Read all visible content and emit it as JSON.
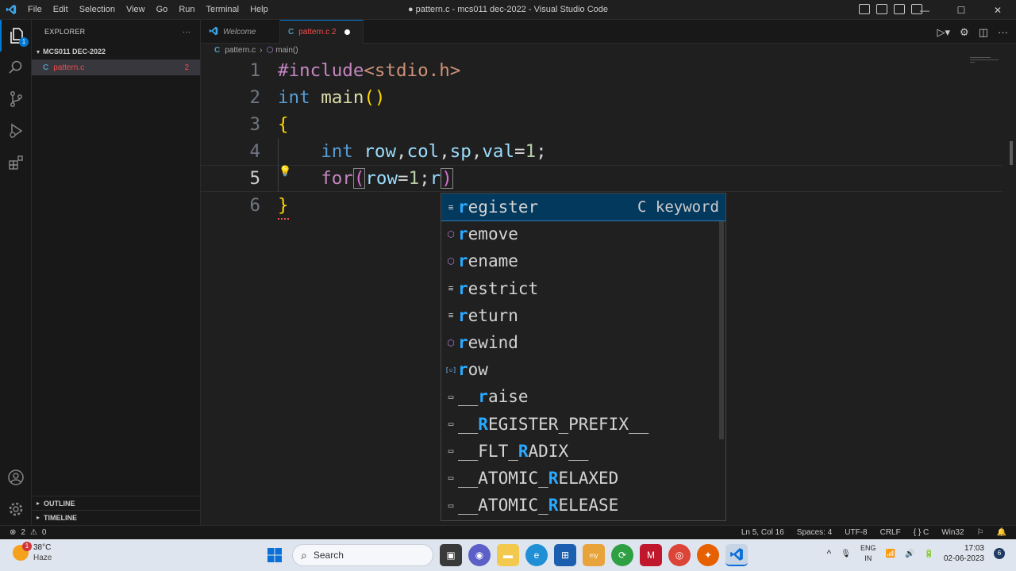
{
  "titlebar": {
    "menu": [
      "File",
      "Edit",
      "Selection",
      "View",
      "Go",
      "Run",
      "Terminal",
      "Help"
    ],
    "window_title": "● pattern.c - mcs011 dec-2022 - Visual Studio Code",
    "minimize": "—",
    "maximize": "☐",
    "close": "✕"
  },
  "activity_bar": {
    "explorer_badge": "1",
    "icons": [
      "files-icon",
      "search-icon",
      "source-control-icon",
      "run-debug-icon",
      "extensions-icon",
      "account-icon",
      "settings-gear-icon"
    ]
  },
  "sidebar": {
    "title": "EXPLORER",
    "more": "···",
    "folder": "MCS011 DEC-2022",
    "file": {
      "icon": "C",
      "name": "pattern.c",
      "problems": "2"
    },
    "outline": "OUTLINE",
    "timeline": "TIMELINE"
  },
  "tabs": [
    {
      "label": "Welcome",
      "icon": "vscode-logo-icon"
    },
    {
      "label": "pattern.c 2",
      "icon": "C",
      "modified": true
    }
  ],
  "breadcrumb": {
    "file": "pattern.c",
    "symbol": "main()"
  },
  "editor": {
    "line_numbers": [
      "1",
      "2",
      "3",
      "4",
      "5",
      "6"
    ],
    "current_line": 5
  },
  "suggestions": [
    {
      "label": "register",
      "match": "r",
      "icon": "keyword-icon",
      "detail": "C keyword"
    },
    {
      "label": "remove",
      "match": "r",
      "icon": "function-icon"
    },
    {
      "label": "rename",
      "match": "r",
      "icon": "function-icon"
    },
    {
      "label": "restrict",
      "match": "r",
      "icon": "keyword-icon"
    },
    {
      "label": "return",
      "match": "r",
      "icon": "keyword-icon"
    },
    {
      "label": "rewind",
      "match": "r",
      "icon": "function-icon"
    },
    {
      "label": "row",
      "match": "r",
      "icon": "variable-icon"
    },
    {
      "label": "__raise",
      "match": "r",
      "icon": "text-icon"
    },
    {
      "label": "__REGISTER_PREFIX__",
      "match": "R",
      "icon": "text-icon"
    },
    {
      "label": "__FLT_RADIX__",
      "match": "R",
      "icon": "text-icon"
    },
    {
      "label": "__ATOMIC_RELAXED",
      "match": "R",
      "icon": "text-icon"
    },
    {
      "label": "__ATOMIC_RELEASE",
      "match": "R",
      "icon": "text-icon"
    }
  ],
  "statusbar": {
    "errors": "2",
    "warnings": "0",
    "position": "Ln 5, Col 16",
    "spaces": "Spaces: 4",
    "encoding": "UTF-8",
    "eol": "CRLF",
    "language": "C",
    "config": "Win32"
  },
  "taskbar": {
    "weather_temp": "38°C",
    "weather_desc": "Haze",
    "weather_badge": "1",
    "search_placeholder": "Search",
    "lang_top": "ENG",
    "lang_bottom": "IN",
    "time": "17:03",
    "date": "02-06-2023",
    "notif_count": "6"
  },
  "colors": {
    "accent": "#0078d4",
    "error": "#f14c4c",
    "suggest_highlight": "#2aaaff"
  }
}
